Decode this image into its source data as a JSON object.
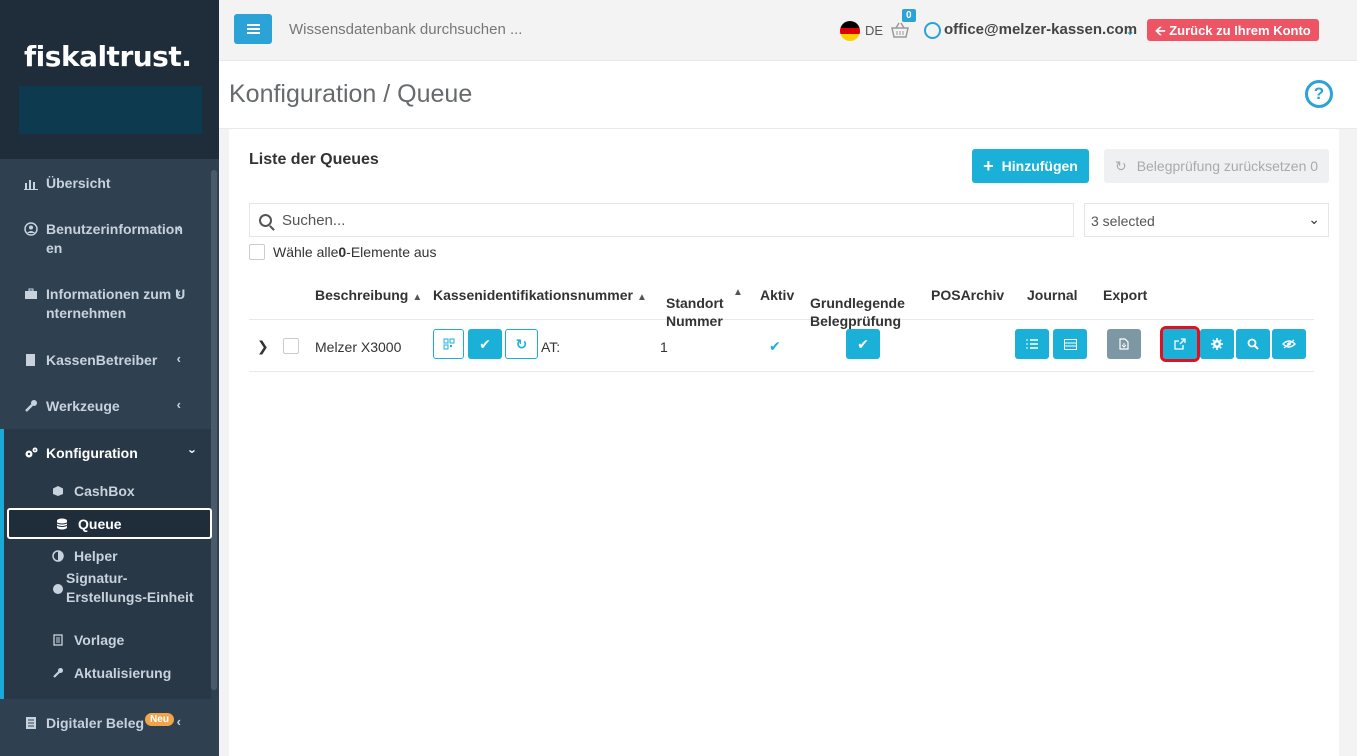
{
  "brand": {
    "logo": "fiskaltrust."
  },
  "sidebar": {
    "items": [
      {
        "label": "Übersicht"
      },
      {
        "label": "Benutzerinformation\nen"
      },
      {
        "label": "Informationen zum U\nnternehmen"
      },
      {
        "label": "KassenBetreiber"
      },
      {
        "label": "Werkzeuge"
      },
      {
        "label": "Konfiguration"
      },
      {
        "label": "Digitaler Beleg",
        "badge": "Neu"
      }
    ],
    "sub_items": [
      {
        "label": "CashBox"
      },
      {
        "label": "Queue"
      },
      {
        "label": "Helper"
      },
      {
        "label": "Signatur-\nErstellungs-Einheit"
      },
      {
        "label": "Vorlage"
      },
      {
        "label": "Aktualisierung"
      }
    ]
  },
  "topbar": {
    "search_placeholder": "Wissensdatenbank durchsuchen ...",
    "language": "DE",
    "cart_count": "0",
    "user_email": "office@melzer-kassen.com",
    "back_button": "Zurück zu Ihrem Konto"
  },
  "page": {
    "title": "Konfiguration / Queue",
    "help": "?"
  },
  "panel": {
    "title": "Liste der Queues",
    "add_button": "Hinzufügen",
    "reset_button": "Belegprüfung zurücksetzen 0",
    "search_placeholder": "Suchen...",
    "select_value": "3 selected",
    "select_all_prefix": "Wähle alle ",
    "select_all_count": "0",
    "select_all_suffix": "-Elemente aus"
  },
  "table": {
    "headers": {
      "beschreibung": "Beschreibung",
      "kassen_id": "Kassenidentifikationsnummer",
      "standort": "Standort\nNummer",
      "aktiv": "Aktiv",
      "grundlegende": "Grundlegende\nBelegprüfung",
      "posarchiv": "POSArchiv",
      "journal": "Journal",
      "export": "Export"
    },
    "rows": [
      {
        "beschreibung": "Melzer X3000",
        "kassen_id": "AT:",
        "standort": "1",
        "aktiv": "✔"
      }
    ]
  },
  "colors": {
    "accent": "#1ab0d8",
    "sidebar": "#2f4050",
    "danger": "#ed5565",
    "highlight": "#e0101e"
  }
}
